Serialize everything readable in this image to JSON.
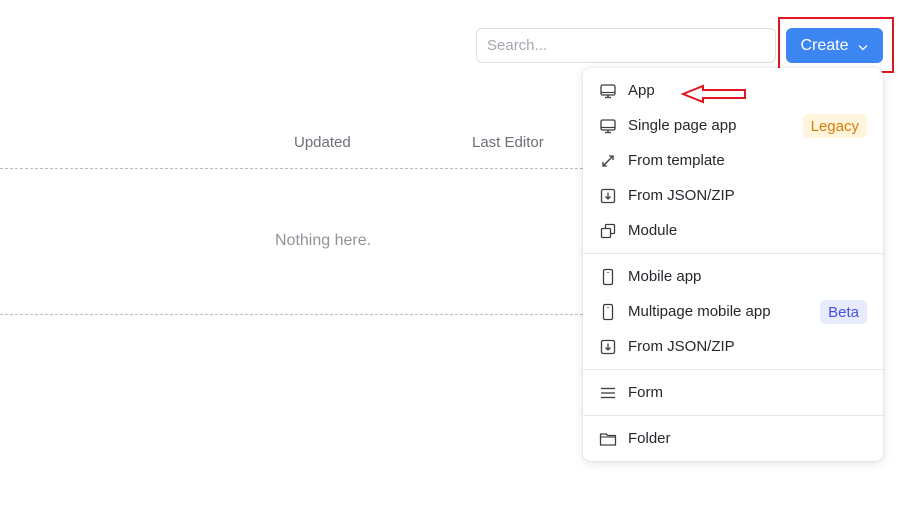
{
  "toolbar": {
    "search_placeholder": "Search...",
    "search_value": "",
    "create_label": "Create",
    "create_icon": "chevron-down-icon"
  },
  "table": {
    "columns": [
      "Updated",
      "Last Editor"
    ],
    "empty_message": "Nothing here."
  },
  "create_menu": {
    "groups": [
      {
        "items": [
          {
            "label": "App",
            "icon": "monitor-icon",
            "badge": null
          },
          {
            "label": "Single page app",
            "icon": "monitor-icon",
            "badge": "Legacy"
          },
          {
            "label": "From template",
            "icon": "expand-arrows-icon",
            "badge": null
          },
          {
            "label": "From JSON/ZIP",
            "icon": "import-icon",
            "badge": null
          },
          {
            "label": "Module",
            "icon": "module-copy-icon",
            "badge": null
          }
        ]
      },
      {
        "items": [
          {
            "label": "Mobile app",
            "icon": "mobile-icon",
            "badge": null
          },
          {
            "label": "Multipage mobile app",
            "icon": "mobile-icon",
            "badge": "Beta"
          },
          {
            "label": "From JSON/ZIP",
            "icon": "import-icon",
            "badge": null
          }
        ]
      },
      {
        "items": [
          {
            "label": "Form",
            "icon": "form-lines-icon",
            "badge": null
          }
        ]
      },
      {
        "items": [
          {
            "label": "Folder",
            "icon": "folder-icon",
            "badge": null
          }
        ]
      }
    ]
  },
  "annotations": {
    "highlight": "create-button",
    "arrow_target": "App"
  },
  "colors": {
    "primary": "#3d86f2",
    "annotation_red": "#e0151f",
    "legacy_bg": "#fff5dc",
    "legacy_text": "#d97b06",
    "beta_bg": "#e8ebfd",
    "beta_text": "#4b4fe0"
  }
}
